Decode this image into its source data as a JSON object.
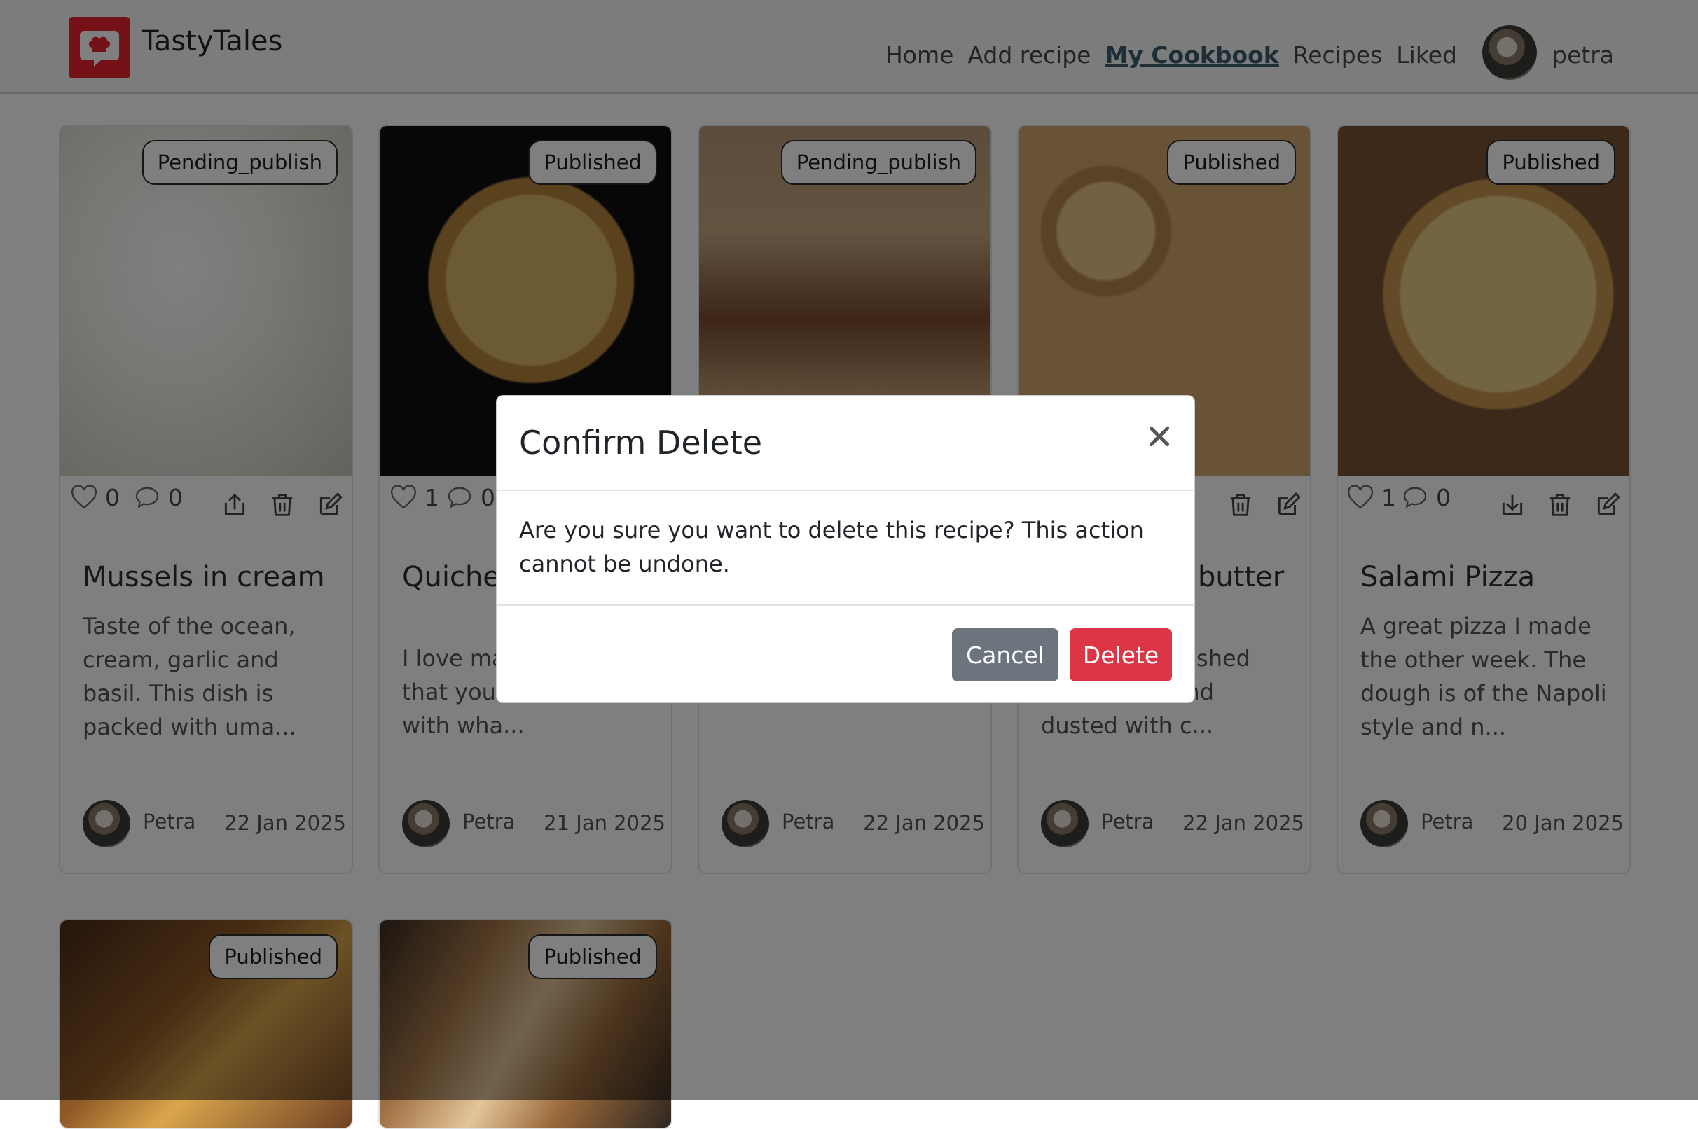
{
  "navbar": {
    "brand": "TastyTales",
    "links": [
      "Home",
      "Add recipe",
      "My Cookbook",
      "Recipes",
      "Liked"
    ],
    "active_link": "My Cookbook",
    "username": "petra"
  },
  "cards": [
    {
      "title": "Mussels in cream",
      "status": "Pending_publish",
      "likes": "0",
      "comments": "0",
      "description": "Taste of the ocean, cream, garlic and basil. This dish is packed with uma...",
      "author": "Petra",
      "date": "22 Jan 2025"
    },
    {
      "title": "Quiche with lov",
      "status": "Published",
      "likes": "1",
      "comments": "0",
      "description": "I love mak quiche o that you can stuff it with wha...",
      "author": "Petra",
      "date": "21 Jan 2025"
    },
    {
      "title": "",
      "status": "Pending_publish",
      "likes": "",
      "comments": "",
      "description": "",
      "author": "Petra",
      "date": "22 Jan 2025"
    },
    {
      "title": "butter",
      "status": "Published",
      "likes": "",
      "comments": "",
      "description": "ed with e, brushed with butter and dusted with c...",
      "author": "Petra",
      "date": "22 Jan 2025"
    },
    {
      "title": "Salami Pizza",
      "status": "Published",
      "likes": "1",
      "comments": "0",
      "description": "A great pizza I made the other week. The dough is of the Napoli style and n...",
      "author": "Petra",
      "date": "20 Jan 2025"
    },
    {
      "title": "",
      "status": "Published",
      "likes": "",
      "comments": "",
      "description": "",
      "author": "",
      "date": ""
    },
    {
      "title": "",
      "status": "Published",
      "likes": "",
      "comments": "",
      "description": "",
      "author": "",
      "date": ""
    }
  ],
  "modal": {
    "title": "Confirm Delete",
    "message": "Are you sure you want to delete this recipe? This action cannot be undone.",
    "cancel_label": "Cancel",
    "delete_label": "Delete"
  },
  "icons": {
    "like": "heart-icon",
    "comment": "comment-icon",
    "unpublish": "upload-icon",
    "publish": "download-icon",
    "delete": "trash-icon",
    "edit": "edit-icon",
    "close": "close-icon"
  },
  "colors": {
    "brand": "#e8242e",
    "danger": "#dc3545",
    "secondary": "#6c757d",
    "active_link": "#3d5d6d"
  }
}
